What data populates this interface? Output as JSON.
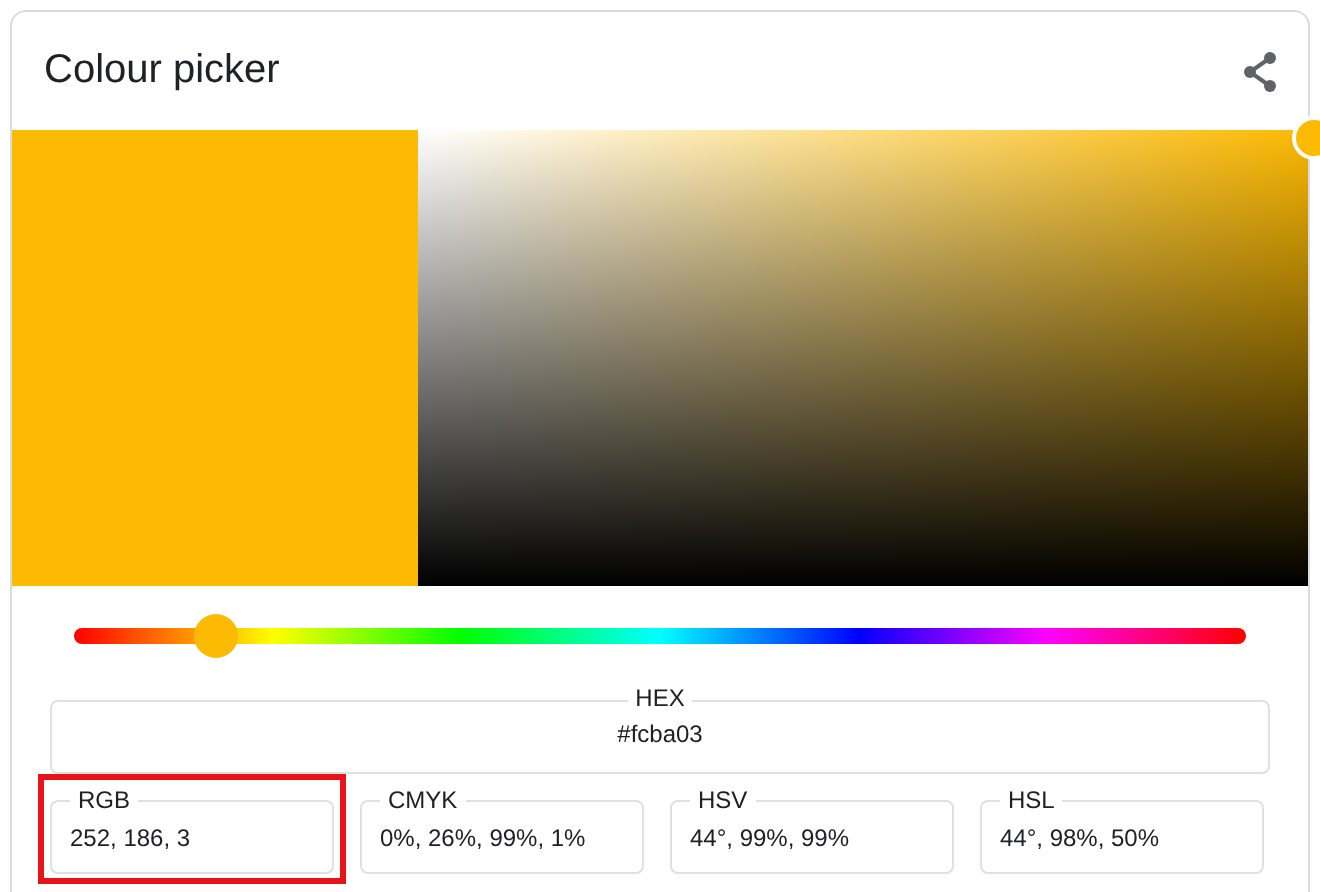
{
  "title": "Colour picker",
  "hue_slider": {
    "level": 0.122
  },
  "hex": {
    "label": "HEX",
    "value": "#fcba03"
  },
  "formats": [
    {
      "label": "RGB",
      "value": "252, 186, 3",
      "selected": true
    },
    {
      "label": "CMYK",
      "value": "0%, 26%, 99%, 1%",
      "selected": false
    },
    {
      "label": "HSV",
      "value": "44°, 99%, 99%",
      "selected": false
    },
    {
      "label": "HSL",
      "value": "44°, 98%, 50%",
      "selected": false
    }
  ]
}
